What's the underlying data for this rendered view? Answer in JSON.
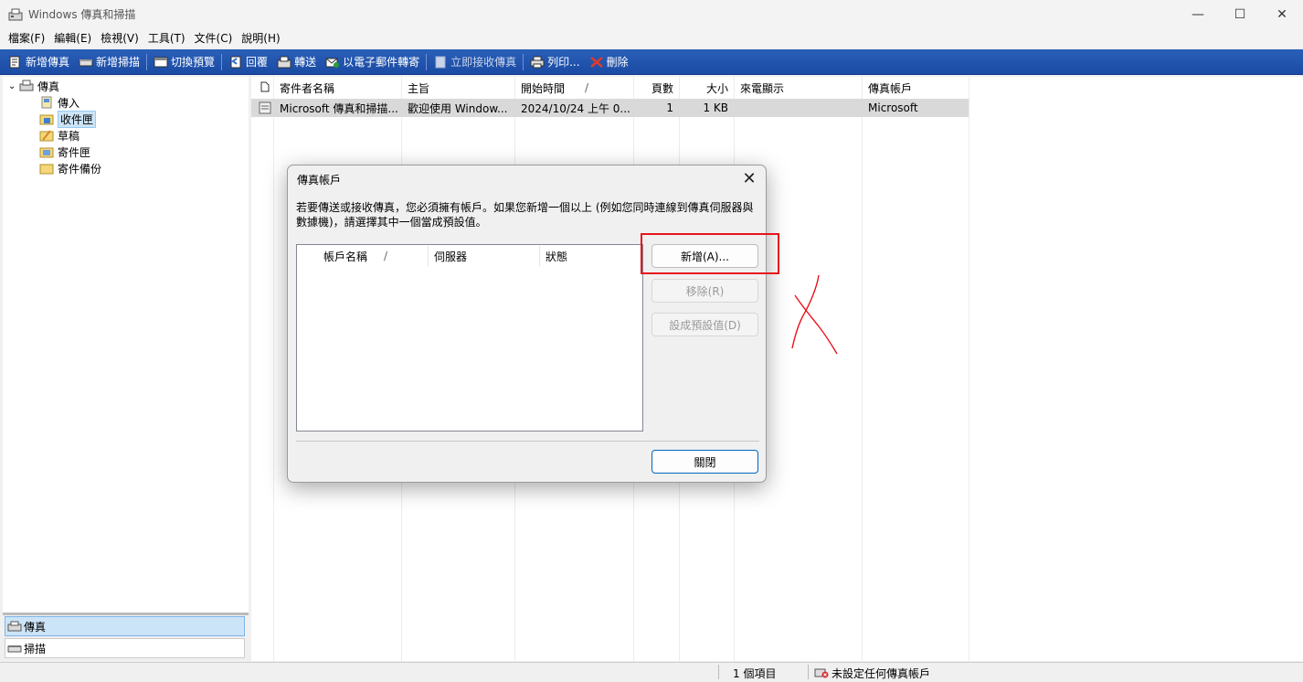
{
  "window": {
    "title": "Windows 傳真和掃描",
    "controls": {
      "minimize": "—",
      "maximize": "☐",
      "close": "✕"
    }
  },
  "menu": [
    "檔案(F)",
    "編輯(E)",
    "檢視(V)",
    "工具(T)",
    "文件(C)",
    "說明(H)"
  ],
  "toolbar": {
    "new_fax": "新增傳真",
    "new_scan": "新增掃描",
    "toggle_preview": "切換預覽",
    "reply": "回覆",
    "forward": "轉送",
    "forward_email": "以電子郵件轉寄",
    "receive_now": "立即接收傳真",
    "print": "列印...",
    "delete": "刪除"
  },
  "tree": {
    "root": "傳真",
    "items": [
      "傳入",
      "收件匣",
      "草稿",
      "寄件匣",
      "寄件備份"
    ],
    "selected": "收件匣"
  },
  "bottom_nav": {
    "fax": "傳真",
    "scan": "掃描"
  },
  "list": {
    "columns": [
      "寄件者名稱",
      "主旨",
      "開始時間",
      "頁數",
      "大小",
      "來電顯示",
      "傳真帳戶"
    ],
    "sort_indicator": "/",
    "rows": [
      {
        "sender": "Microsoft 傳真和掃描...",
        "subject": "歡迎使用 Window...",
        "start_time": "2024/10/24 上午 0...",
        "pages": "1",
        "size": "1 KB",
        "caller_id": "",
        "account": "Microsoft"
      }
    ]
  },
  "status": {
    "count": "1 個項目",
    "account_status": "未設定任何傳真帳戶"
  },
  "dialog": {
    "title": "傳真帳戶",
    "close": "✕",
    "description": "若要傳送或接收傳真，您必須擁有帳戶。如果您新增一個以上 (例如您同時連線到傳真伺服器與數據機)，請選擇其中一個當成預設值。",
    "columns": [
      "帳戶名稱",
      "伺服器",
      "狀態"
    ],
    "sort_indicator": "/",
    "buttons": {
      "add": "新增(A)...",
      "remove": "移除(R)",
      "set_default": "設成預設值(D)",
      "close": "關閉"
    }
  },
  "annotation_color": "#e8141c"
}
